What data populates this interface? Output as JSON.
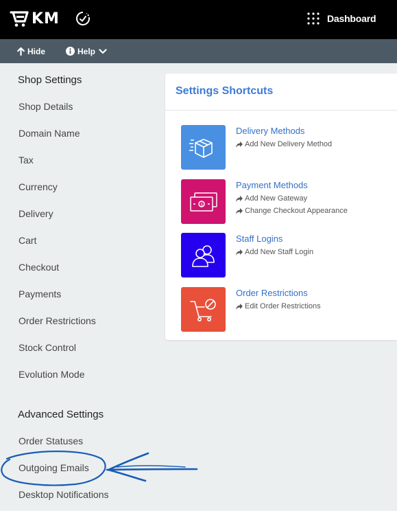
{
  "header": {
    "logo_text": "KM",
    "dashboard_label": "Dashboard"
  },
  "subbar": {
    "hide_label": "Hide",
    "help_label": "Help"
  },
  "sidebar": {
    "shop_settings_heading": "Shop Settings",
    "shop_items": [
      "Shop Details",
      "Domain Name",
      "Tax",
      "Currency",
      "Delivery",
      "Cart",
      "Checkout",
      "Payments",
      "Order Restrictions",
      "Stock Control",
      "Evolution Mode"
    ],
    "advanced_heading": "Advanced Settings",
    "advanced_items": [
      "Order Statuses",
      "Outgoing Emails",
      "Desktop Notifications"
    ]
  },
  "shortcuts": {
    "title": "Settings Shortcuts",
    "items": [
      {
        "title": "Delivery Methods",
        "links": [
          "Add New Delivery Method"
        ],
        "color": "#4a90e2",
        "icon": "package-icon"
      },
      {
        "title": "Payment Methods",
        "links": [
          "Add New Gateway",
          "Change Checkout Appearance"
        ],
        "color": "#d0136f",
        "icon": "banknote-icon"
      },
      {
        "title": "Staff Logins",
        "links": [
          "Add New Staff Login"
        ],
        "color": "#2400ee",
        "icon": "users-icon"
      },
      {
        "title": "Order Restrictions",
        "links": [
          "Edit Order Restrictions"
        ],
        "color": "#e8503a",
        "icon": "cart-blocked-icon"
      }
    ]
  },
  "colors": {
    "topbar": "#000000",
    "subbar": "#4c5a66",
    "accent": "#3d7bd6",
    "annotation": "#1a5cb5"
  }
}
